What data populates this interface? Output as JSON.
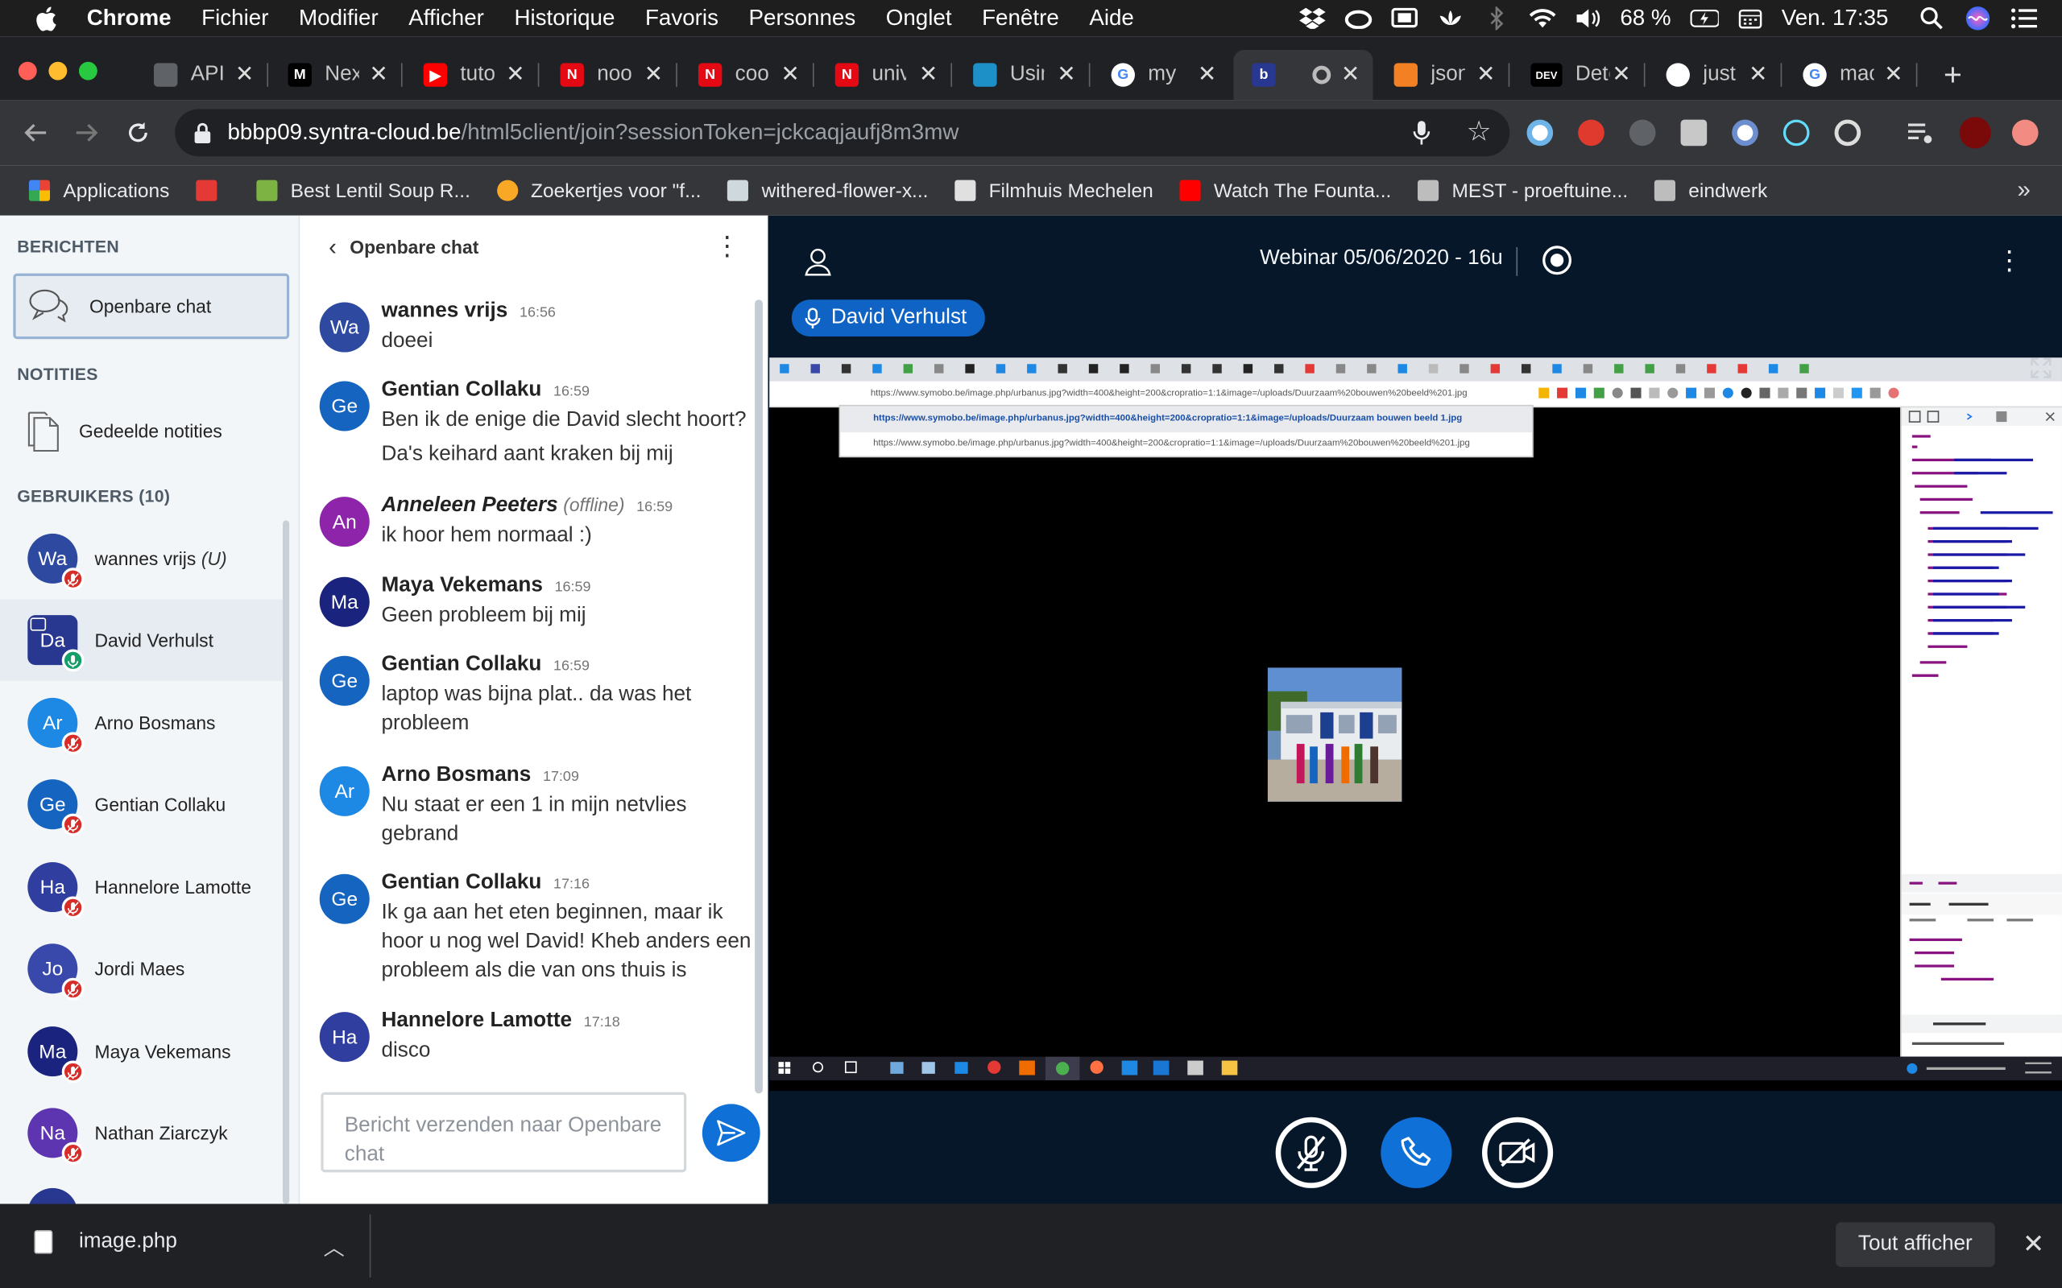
{
  "menubar": {
    "app": "Chrome",
    "items": [
      "Fichier",
      "Modifier",
      "Afficher",
      "Historique",
      "Favoris",
      "Personnes",
      "Onglet",
      "Fenêtre",
      "Aide"
    ],
    "battery": "68 %",
    "clock": "Ven. 17:35"
  },
  "tabs": [
    {
      "title": "API",
      "icon": "globe-icon",
      "color": "#5f6368",
      "glyph": ""
    },
    {
      "title": "Nex",
      "icon": "medium-m-icon",
      "color": "#000000",
      "glyph": "M"
    },
    {
      "title": "tuto",
      "icon": "youtube-icon",
      "color": "#ff0000",
      "glyph": "▶"
    },
    {
      "title": "noo",
      "icon": "netflix-n-icon",
      "color": "#e50914",
      "glyph": "N"
    },
    {
      "title": "coo",
      "icon": "netflix-n-icon",
      "color": "#e50914",
      "glyph": "N"
    },
    {
      "title": "univ",
      "icon": "netflix-n-icon",
      "color": "#e50914",
      "glyph": "N"
    },
    {
      "title": "Usin",
      "icon": "bookmark-app-icon",
      "color": "#1e90c8",
      "glyph": ""
    },
    {
      "title": "my c",
      "icon": "google-icon",
      "color": "#ffffff",
      "glyph": "G"
    },
    {
      "title": "",
      "icon": "bigbluebutton-icon",
      "color": "#283891",
      "glyph": "b"
    },
    {
      "title": "json",
      "icon": "stackoverflow-icon",
      "color": "#f48024",
      "glyph": ""
    },
    {
      "title": "Dete",
      "icon": "dev-icon",
      "color": "#000000",
      "glyph": "DEV"
    },
    {
      "title": "just",
      "icon": "github-icon",
      "color": "#ffffff",
      "glyph": ""
    },
    {
      "title": "mac",
      "icon": "google-icon",
      "color": "#ffffff",
      "glyph": "G"
    }
  ],
  "omnibox": {
    "host": "bbbp09.syntra-cloud.be",
    "path": "/html5client/join?sessionToken=jckcaqjaufj8m3mw"
  },
  "bookmarks": [
    {
      "label": "Applications",
      "icon": "apps-grid-icon",
      "color": "#ea4335"
    },
    {
      "label": "",
      "icon": "r-logo-icon",
      "color": "#e53935"
    },
    {
      "label": "Best Lentil Soup R...",
      "icon": "recipe-icon",
      "color": "#7cb342"
    },
    {
      "label": "Zoekertjes voor \"f...",
      "icon": "two-badge-icon",
      "color": "#f9a825"
    },
    {
      "label": "withered-flower-x...",
      "icon": "cube-icon",
      "color": "#cfd8dc"
    },
    {
      "label": "Filmhuis Mechelen",
      "icon": "filmhuis-icon",
      "color": "#e0e0e0"
    },
    {
      "label": "Watch The Founta...",
      "icon": "youtube-icon",
      "color": "#ff0000"
    },
    {
      "label": "MEST - proeftuine...",
      "icon": "m-logo-icon",
      "color": "#bdbdbd"
    },
    {
      "label": "eindwerk",
      "icon": "folder-icon",
      "color": "#bdbdbd"
    }
  ],
  "sidebar": {
    "messages_header": "BERICHTEN",
    "public_chat": "Openbare chat",
    "notes_header": "NOTITIES",
    "shared_notes": "Gedeelde notities",
    "users_header": "GEBRUIKERS (10)",
    "users": [
      {
        "initials": "Wa",
        "name": "wannes vrijs",
        "suffix": "(U)",
        "color": "#2e4aa0",
        "status": "muted"
      },
      {
        "initials": "Da",
        "name": "David Verhulst",
        "suffix": "",
        "color": "#283891",
        "status": "talking"
      },
      {
        "initials": "Ar",
        "name": "Arno Bosmans",
        "suffix": "",
        "color": "#1e88e5",
        "status": "muted"
      },
      {
        "initials": "Ge",
        "name": "Gentian Collaku",
        "suffix": "",
        "color": "#1565c0",
        "status": "muted"
      },
      {
        "initials": "Ha",
        "name": "Hannelore Lamotte",
        "suffix": "",
        "color": "#303f9f",
        "status": "muted"
      },
      {
        "initials": "Jo",
        "name": "Jordi Maes",
        "suffix": "",
        "color": "#3949ab",
        "status": "muted"
      },
      {
        "initials": "Ma",
        "name": "Maya Vekemans",
        "suffix": "",
        "color": "#1a237e",
        "status": "muted"
      },
      {
        "initials": "Na",
        "name": "Nathan Ziarczyk",
        "suffix": "",
        "color": "#5e35b1",
        "status": "muted"
      }
    ]
  },
  "chat": {
    "title": "Openbare chat",
    "messages": [
      {
        "initials": "Wa",
        "color": "#2e4aa0",
        "name": "wannes vrijs",
        "offline": "",
        "time": "16:56",
        "lines": [
          "doeei"
        ]
      },
      {
        "initials": "Ge",
        "color": "#1565c0",
        "name": "Gentian Collaku",
        "offline": "",
        "time": "16:59",
        "lines": [
          "Ben ik de enige die David slecht hoort?",
          "Da's keihard aant kraken bij mij"
        ]
      },
      {
        "initials": "An",
        "color": "#8e24aa",
        "name": "Anneleen Peeters",
        "offline": "(offline)",
        "time": "16:59",
        "lines": [
          "ik hoor hem normaal :)"
        ]
      },
      {
        "initials": "Ma",
        "color": "#1a237e",
        "name": "Maya Vekemans",
        "offline": "",
        "time": "16:59",
        "lines": [
          "Geen probleem bij mij"
        ]
      },
      {
        "initials": "Ge",
        "color": "#1565c0",
        "name": "Gentian Collaku",
        "offline": "",
        "time": "16:59",
        "lines": [
          "laptop was bijna plat.. da was het probleem"
        ]
      },
      {
        "initials": "Ar",
        "color": "#1e88e5",
        "name": "Arno Bosmans",
        "offline": "",
        "time": "17:09",
        "lines": [
          "Nu staat er een 1 in mijn netvlies gebrand"
        ]
      },
      {
        "initials": "Ge",
        "color": "#1565c0",
        "name": "Gentian Collaku",
        "offline": "",
        "time": "17:16",
        "lines": [
          "Ik ga aan het eten beginnen, maar ik hoor u nog wel David! Kheb anders een probleem als die van ons thuis is"
        ]
      },
      {
        "initials": "Ha",
        "color": "#303f9f",
        "name": "Hannelore Lamotte",
        "offline": "",
        "time": "17:18",
        "lines": [
          "disco"
        ]
      }
    ],
    "input_placeholder": "Bericht verzenden naar Openbare chat"
  },
  "stage": {
    "title": "Webinar 05/06/2020 - 16u",
    "talker": "David Verhulst",
    "shared_url": "https://www.symobo.be/image.php/urbanus.jpg?width=400&height=200&cropratio=1:1&image=/uploads/Duurzaam%20bouwen%20beeld%201.jpg",
    "suggestion_1": "https://www.symobo.be/image.php/urbanus.jpg?width=400&height=200&cropratio=1:1&image=/uploads/Duurzaam bouwen beeld 1.jpg",
    "suggestion_2": "https://www.symobo.be/image.php/urbanus.jpg?width=400&height=200&cropratio=1:1&image=/uploads/Duurzaam%20bouwen%20beeld%201.jpg"
  },
  "download": {
    "file": "image.php",
    "show_all": "Tout afficher"
  }
}
